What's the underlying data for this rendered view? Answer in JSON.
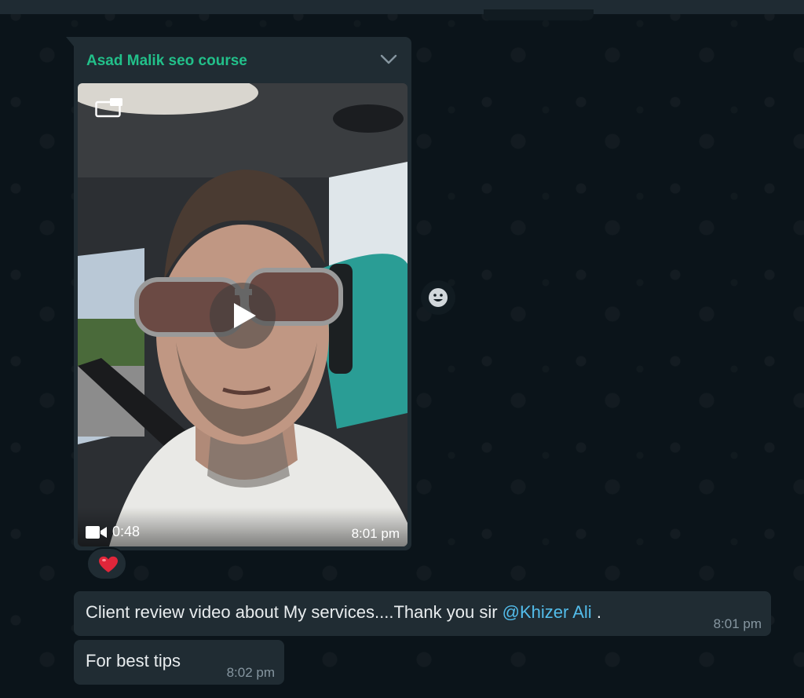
{
  "message_media": {
    "sender": "Asad Malik seo course",
    "video_duration": "0:48",
    "time": "8:01 pm",
    "icons": {
      "menu": "chevron-down-icon",
      "pip": "picture-in-picture-icon",
      "play": "play-icon",
      "video": "video-camera-icon"
    }
  },
  "reaction": {
    "emoji": "❤️",
    "icon": "heart-icon"
  },
  "emoji_button": {
    "icon": "smiley-icon"
  },
  "messages": [
    {
      "text": "Client review video about My services....Thank you sir ",
      "mention": "@Khizer Ali",
      "suffix": " .",
      "time": "8:01 pm"
    },
    {
      "text": "For best tips",
      "time": "8:02 pm"
    }
  ],
  "colors": {
    "background": "#0b141a",
    "bubble": "#202c33",
    "sender_name": "#22c08a",
    "mention": "#53bdeb",
    "text": "#e9edef",
    "meta": "#8696a0"
  }
}
